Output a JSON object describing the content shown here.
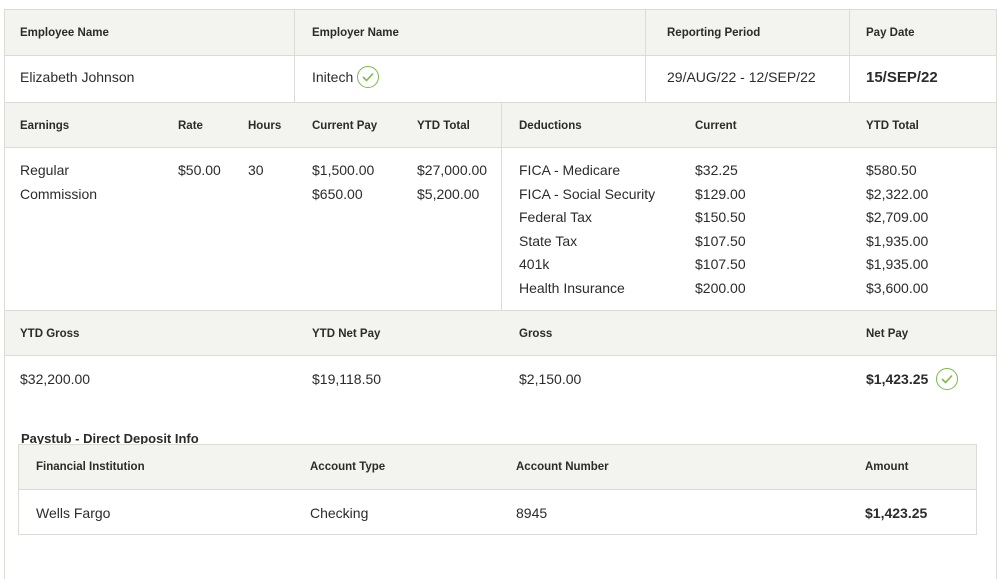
{
  "header": {
    "employee_name_label": "Employee Name",
    "employer_name_label": "Employer Name",
    "reporting_period_label": "Reporting Period",
    "pay_date_label": "Pay Date",
    "employee_name": "Elizabeth Johnson",
    "employer_name": "Initech",
    "reporting_period": "29/AUG/22 - 12/SEP/22",
    "pay_date": "15/SEP/22"
  },
  "earnings": {
    "headers": [
      "Earnings",
      "Rate",
      "Hours",
      "Current Pay",
      "YTD Total"
    ],
    "rows": [
      {
        "type": "Regular",
        "rate": "$50.00",
        "hours": "30",
        "current": "$1,500.00",
        "ytd": "$27,000.00"
      },
      {
        "type": "Commission",
        "rate": "",
        "hours": "",
        "current": "$650.00",
        "ytd": "$5,200.00"
      }
    ]
  },
  "deductions": {
    "headers": [
      "Deductions",
      "Current",
      "YTD Total"
    ],
    "rows": [
      {
        "name": "FICA - Medicare",
        "current": "$32.25",
        "ytd": "$580.50"
      },
      {
        "name": "FICA - Social Security",
        "current": "$129.00",
        "ytd": "$2,322.00"
      },
      {
        "name": "Federal Tax",
        "current": "$150.50",
        "ytd": "$2,709.00"
      },
      {
        "name": "State Tax",
        "current": "$107.50",
        "ytd": "$1,935.00"
      },
      {
        "name": "401k",
        "current": "$107.50",
        "ytd": "$1,935.00"
      },
      {
        "name": "Health Insurance",
        "current": "$200.00",
        "ytd": "$3,600.00"
      }
    ]
  },
  "totals": {
    "ytd_gross_label": "YTD Gross",
    "ytd_net_label": "YTD Net Pay",
    "gross_label": "Gross",
    "net_label": "Net Pay",
    "ytd_gross": "$32,200.00",
    "ytd_net": "$19,118.50",
    "gross": "$2,150.00",
    "net": "$1,423.25"
  },
  "direct_deposit": {
    "title": "Paystub - Direct Deposit Info",
    "headers": [
      "Financial Institution",
      "Account Type",
      "Account Number",
      "Amount"
    ],
    "row": {
      "institution": "Wells Fargo",
      "account_type": "Checking",
      "account_number": "8945",
      "amount": "$1,423.25"
    }
  },
  "colors": {
    "check_green": "#7db84a",
    "header_bg": "#f3f3ef",
    "border": "#dcdcd6"
  }
}
